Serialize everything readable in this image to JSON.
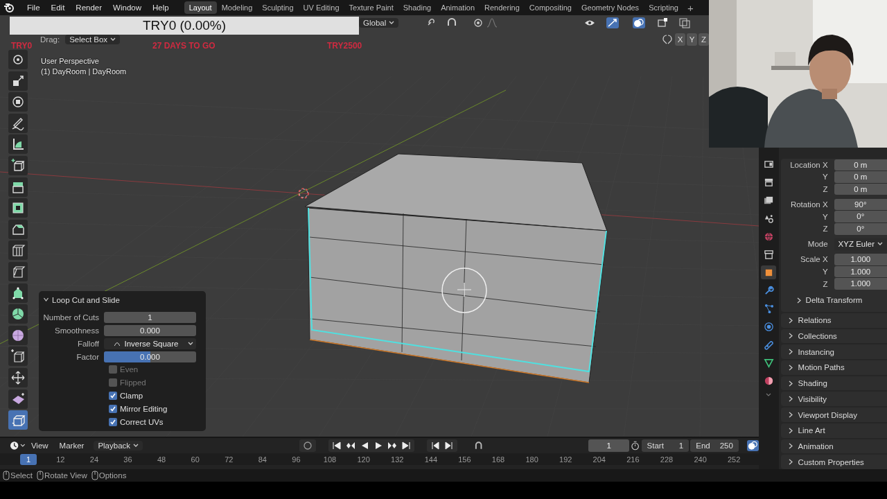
{
  "menu_bar": {
    "items": [
      "File",
      "Edit",
      "Render",
      "Window",
      "Help"
    ]
  },
  "workspace_tabs": [
    {
      "label": "Layout",
      "selected": true
    },
    {
      "label": "Modeling",
      "selected": false
    },
    {
      "label": "Sculpting",
      "selected": false
    },
    {
      "label": "UV Editing",
      "selected": false
    },
    {
      "label": "Texture Paint",
      "selected": false
    },
    {
      "label": "Shading",
      "selected": false
    },
    {
      "label": "Animation",
      "selected": false
    },
    {
      "label": "Rendering",
      "selected": false
    },
    {
      "label": "Compositing",
      "selected": false
    },
    {
      "label": "Geometry Nodes",
      "selected": false
    },
    {
      "label": "Scripting",
      "selected": false
    }
  ],
  "add_workspace": "+",
  "progress_banner": {
    "text": "TRY0 (0.00%)"
  },
  "stream_overlay": {
    "texts": [
      "TRY0",
      "27 DAYS TO GO",
      "TRY2500"
    ]
  },
  "viewport": {
    "header": {
      "orientation": "Global",
      "drag_label": "Drag:",
      "drag_value": "Select Box",
      "axis_toggles": [
        "X",
        "Y",
        "Z"
      ]
    },
    "view_name": "User Perspective",
    "object_info": "(1) DayRoom | DayRoom",
    "tools": [
      {
        "kind": "rotate",
        "selected": false
      },
      {
        "kind": "scale",
        "selected": false
      },
      {
        "kind": "transform",
        "selected": false
      },
      {
        "kind": "annotate",
        "selected": false
      },
      {
        "kind": "measure",
        "selected": false
      },
      {
        "kind": "add_cube",
        "selected": false
      },
      {
        "kind": "extrude",
        "selected": false
      },
      {
        "kind": "inset",
        "selected": false
      },
      {
        "kind": "bevel",
        "selected": false
      },
      {
        "kind": "loop_cut",
        "selected": false
      },
      {
        "kind": "knife",
        "selected": false
      },
      {
        "kind": "poly_build",
        "selected": false
      },
      {
        "kind": "spin",
        "selected": false
      },
      {
        "kind": "smooth",
        "selected": false
      },
      {
        "kind": "edge_slide",
        "selected": false
      },
      {
        "kind": "shrink",
        "selected": false
      },
      {
        "kind": "shear",
        "selected": false
      },
      {
        "kind": "rip",
        "selected": true
      }
    ],
    "operator_panel": {
      "title": "Loop Cut and Slide",
      "expanded": true,
      "fields": [
        {
          "kind": "number",
          "label": "Number of Cuts",
          "value": "1"
        },
        {
          "kind": "number",
          "label": "Smoothness",
          "value": "0.000"
        },
        {
          "kind": "dropdown",
          "label": "Falloff",
          "value": "Inverse Square"
        },
        {
          "kind": "slider",
          "label": "Factor",
          "value": "0.000",
          "level": 0.5
        }
      ],
      "options": [
        {
          "label": "Even",
          "checked": false
        },
        {
          "label": "Flipped",
          "checked": false
        },
        {
          "label": "Clamp",
          "checked": true
        },
        {
          "label": "Mirror Editing",
          "checked": true
        },
        {
          "label": "Correct UVs",
          "checked": true
        }
      ]
    }
  },
  "properties": {
    "tabs": [
      {
        "kind": "tool",
        "selected": false
      },
      {
        "kind": "render",
        "selected": false
      },
      {
        "kind": "output",
        "selected": false
      },
      {
        "kind": "scene",
        "selected": false
      },
      {
        "kind": "world",
        "selected": false
      },
      {
        "kind": "collection",
        "selected": false
      },
      {
        "kind": "object",
        "selected": true
      },
      {
        "kind": "modifier",
        "selected": false
      },
      {
        "kind": "particles",
        "selected": false
      },
      {
        "kind": "physics",
        "selected": false
      },
      {
        "kind": "constraints",
        "selected": false
      },
      {
        "kind": "data",
        "selected": false
      },
      {
        "kind": "material",
        "selected": false
      }
    ],
    "transform_groups": [
      {
        "rows": [
          {
            "kind": "number",
            "label": "Location X",
            "value": "0 m"
          },
          {
            "kind": "number",
            "label": "Y",
            "value": "0 m"
          },
          {
            "kind": "number",
            "label": "Z",
            "value": "0 m"
          }
        ]
      },
      {
        "rows": [
          {
            "kind": "number",
            "label": "Rotation X",
            "value": "90°"
          },
          {
            "kind": "number",
            "label": "Y",
            "value": "0°"
          },
          {
            "kind": "number",
            "label": "Z",
            "value": "0°"
          }
        ]
      },
      {
        "rows": [
          {
            "kind": "dropdown",
            "label": "Mode",
            "value": "XYZ Euler"
          }
        ]
      },
      {
        "rows": [
          {
            "kind": "number",
            "label": "Scale X",
            "value": "1.000"
          },
          {
            "kind": "number",
            "label": "Y",
            "value": "1.000"
          },
          {
            "kind": "number",
            "label": "Z",
            "value": "1.000"
          }
        ]
      }
    ],
    "subpanels": [
      {
        "label": "Delta Transform",
        "expanded": false
      }
    ],
    "panels": [
      {
        "label": "Relations",
        "expanded": false
      },
      {
        "label": "Collections",
        "expanded": false
      },
      {
        "label": "Instancing",
        "expanded": false
      },
      {
        "label": "Motion Paths",
        "expanded": false
      },
      {
        "label": "Shading",
        "expanded": false
      },
      {
        "label": "Visibility",
        "expanded": false
      },
      {
        "label": "Viewport Display",
        "expanded": false
      },
      {
        "label": "Line Art",
        "expanded": false
      },
      {
        "label": "Animation",
        "expanded": false
      },
      {
        "label": "Custom Properties",
        "expanded": false
      }
    ]
  },
  "timeline": {
    "menus": [
      "View",
      "Marker"
    ],
    "playback": "Playback",
    "current_frame": "1",
    "start_label": "Start",
    "start": "1",
    "end_label": "End",
    "end": "250",
    "ruler": [
      {
        "label": "1",
        "selected": true
      },
      {
        "label": "12",
        "selected": false
      },
      {
        "label": "24",
        "selected": false
      },
      {
        "label": "36",
        "selected": false
      },
      {
        "label": "48",
        "selected": false
      },
      {
        "label": "60",
        "selected": false
      },
      {
        "label": "72",
        "selected": false
      },
      {
        "label": "84",
        "selected": false
      },
      {
        "label": "96",
        "selected": false
      },
      {
        "label": "108",
        "selected": false
      },
      {
        "label": "120",
        "selected": false
      },
      {
        "label": "132",
        "selected": false
      },
      {
        "label": "144",
        "selected": false
      },
      {
        "label": "156",
        "selected": false
      },
      {
        "label": "168",
        "selected": false
      },
      {
        "label": "180",
        "selected": false
      },
      {
        "label": "192",
        "selected": false
      },
      {
        "label": "204",
        "selected": false
      },
      {
        "label": "216",
        "selected": false
      },
      {
        "label": "228",
        "selected": false
      },
      {
        "label": "240",
        "selected": false
      },
      {
        "label": "252",
        "selected": false
      }
    ]
  },
  "status_bar": {
    "items": [
      "Select",
      "Rotate View",
      "Options"
    ]
  }
}
